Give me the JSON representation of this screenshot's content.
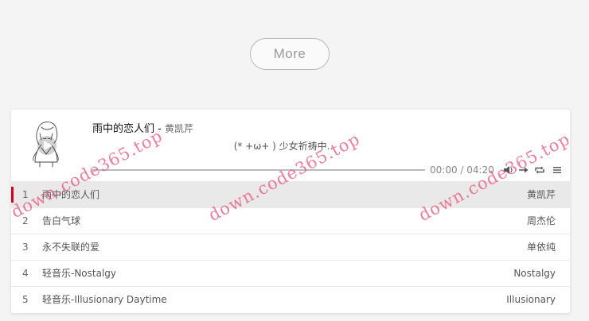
{
  "more_button": {
    "label": "More"
  },
  "player": {
    "title": "雨中的恋人们",
    "separator": " - ",
    "artist": "黄凯芹",
    "lyric": "(* +ω+ ) 少女祈祷中..",
    "time_current": "00:00",
    "time_separator": " / ",
    "time_total": "04:20",
    "progress": 0,
    "controls": [
      "volume-icon",
      "order-icon",
      "loop-icon",
      "menu-icon"
    ],
    "accent_color": "#d0021b"
  },
  "playlist": [
    {
      "index": "1",
      "name": "雨中的恋人们",
      "artist": "黄凯芹",
      "active": true
    },
    {
      "index": "2",
      "name": "告白气球",
      "artist": "周杰伦",
      "active": false
    },
    {
      "index": "3",
      "name": "永不失联的爱",
      "artist": "单依纯",
      "active": false
    },
    {
      "index": "4",
      "name": "轻音乐-Nostalgy",
      "artist": "Nostalgy",
      "active": false
    },
    {
      "index": "5",
      "name": "轻音乐-Illusionary Daytime",
      "artist": "Illusionary",
      "active": false
    }
  ],
  "watermarks": [
    "down.code365.top",
    "down.code365.top",
    "down.code365.top"
  ]
}
